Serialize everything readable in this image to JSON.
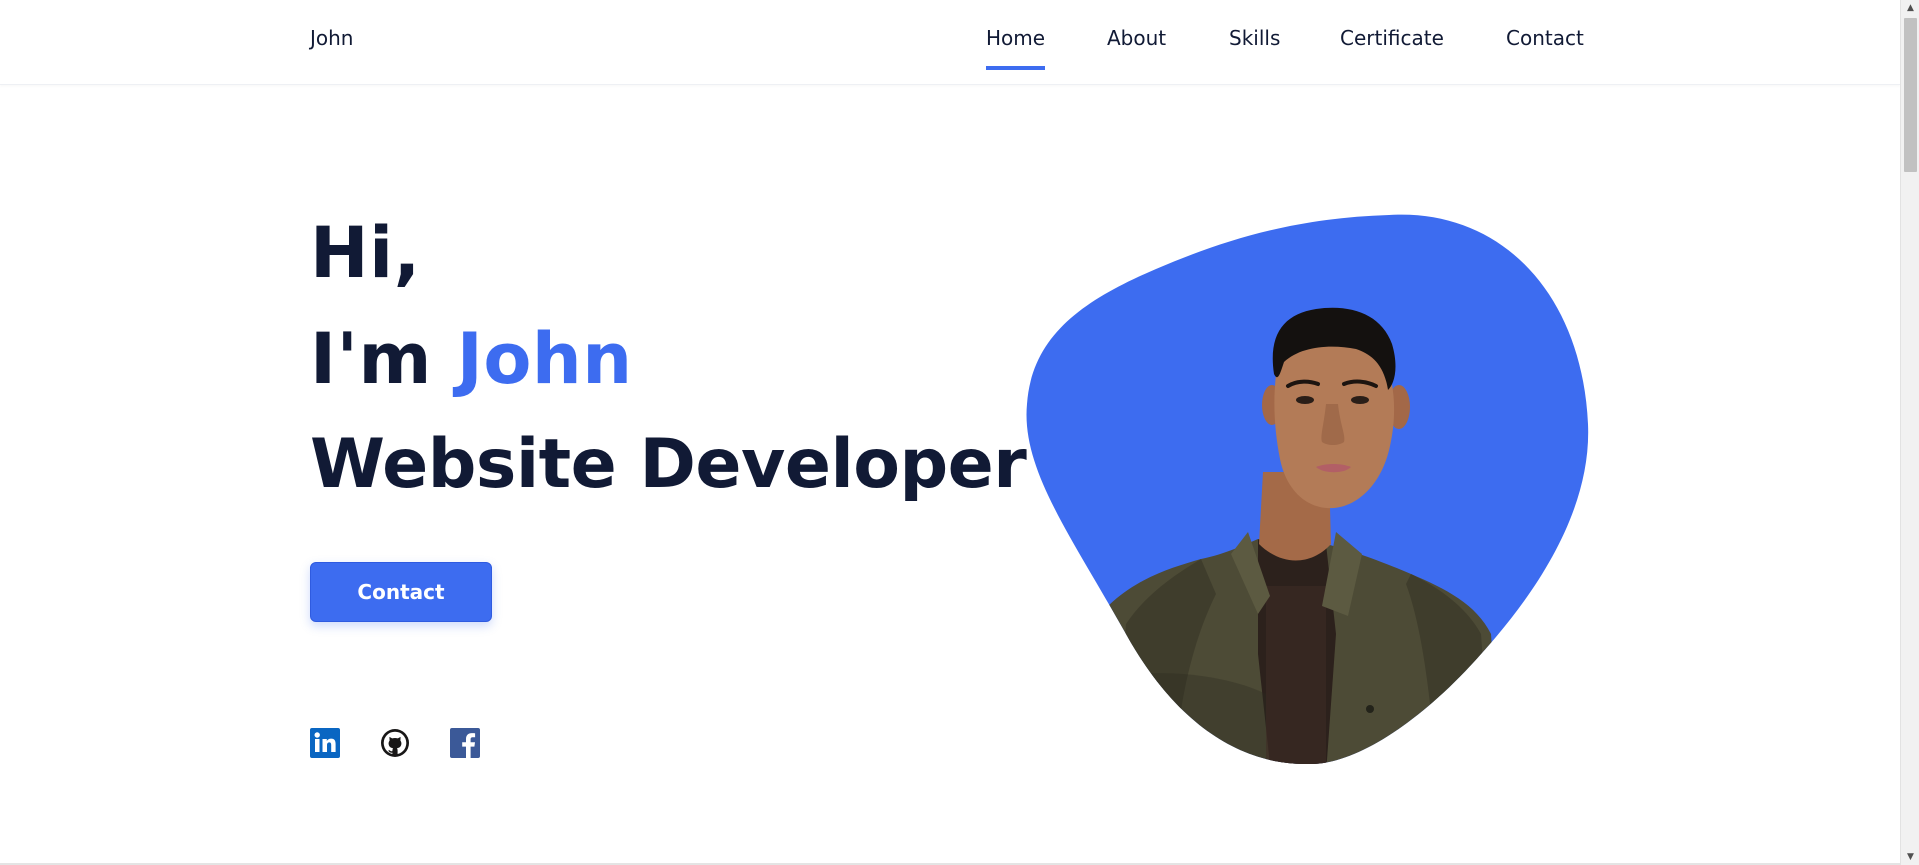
{
  "header": {
    "logo": "John",
    "nav": [
      {
        "label": "Home",
        "active": true
      },
      {
        "label": "About",
        "active": false
      },
      {
        "label": "Skills",
        "active": false
      },
      {
        "label": "Certificate",
        "active": false
      },
      {
        "label": "Contact",
        "active": false
      }
    ]
  },
  "hero": {
    "greeting": "Hi,",
    "intro_prefix": "I'm ",
    "name": "John",
    "role": "Website Developer",
    "button_label": "Contact"
  },
  "social": [
    {
      "icon": "linkedin-icon",
      "color": "#0a66c2"
    },
    {
      "icon": "github-icon",
      "color": "#181717"
    },
    {
      "icon": "facebook-icon",
      "color": "#3b5998"
    }
  ],
  "colors": {
    "accent": "#3d6cf0",
    "text": "#111a35",
    "background": "#ffffff"
  },
  "scrollbar": {
    "up_arrow": "▲",
    "down_arrow": "▼"
  }
}
